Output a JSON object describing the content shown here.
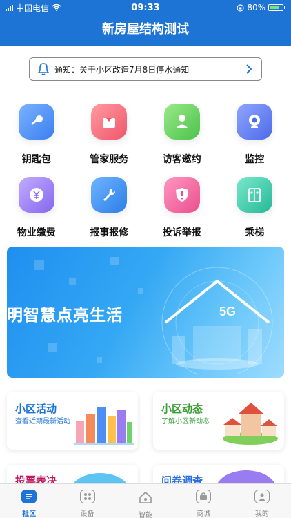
{
  "status_bar": {
    "carrier": "中国电信",
    "time": "09:33",
    "battery": "80%"
  },
  "header": {
    "title": "新房屋结构测试"
  },
  "notice": {
    "icon": "bell-icon",
    "text": "通知：关于小区改造7月8日停水通知"
  },
  "grid": [
    {
      "label": "钥匙包",
      "icon": "key-icon",
      "color": "#4d8ff5"
    },
    {
      "label": "管家服务",
      "icon": "butler-icon",
      "color": "#f56c7a"
    },
    {
      "label": "访客邀约",
      "icon": "visitor-icon",
      "color": "#6fd36a"
    },
    {
      "label": "监控",
      "icon": "camera-icon",
      "color": "#5b79f0"
    },
    {
      "label": "物业缴费",
      "icon": "yuan-icon",
      "color": "#9a7cf2"
    },
    {
      "label": "报事报修",
      "icon": "wrench-icon",
      "color": "#3d8ff2"
    },
    {
      "label": "投诉举报",
      "icon": "alert-shield-icon",
      "color": "#f0669b"
    },
    {
      "label": "乘梯",
      "icon": "elevator-icon",
      "color": "#31c8a8"
    }
  ],
  "banner": {
    "headline": "明智慧点亮生活",
    "badge": "5G"
  },
  "cards": [
    {
      "title": "小区活动",
      "subtitle": "查看近期最新活动",
      "title_color": "#1e74d4"
    },
    {
      "title": "小区动态",
      "subtitle": "了解小区新动态",
      "title_color": "#3aa035"
    }
  ],
  "cards_row2": [
    {
      "title": "投票表决",
      "title_color": "#c2185b"
    },
    {
      "title": "问卷调查",
      "title_color": "#2a6fdb"
    }
  ],
  "tabbar": [
    {
      "label": "社区",
      "icon": "community-icon",
      "active": true
    },
    {
      "label": "设备",
      "icon": "devices-icon",
      "active": false
    },
    {
      "label": "智能",
      "icon": "smart-home-icon",
      "active": false
    },
    {
      "label": "商城",
      "icon": "shop-icon",
      "active": false
    },
    {
      "label": "我的",
      "icon": "profile-icon",
      "active": false
    }
  ]
}
